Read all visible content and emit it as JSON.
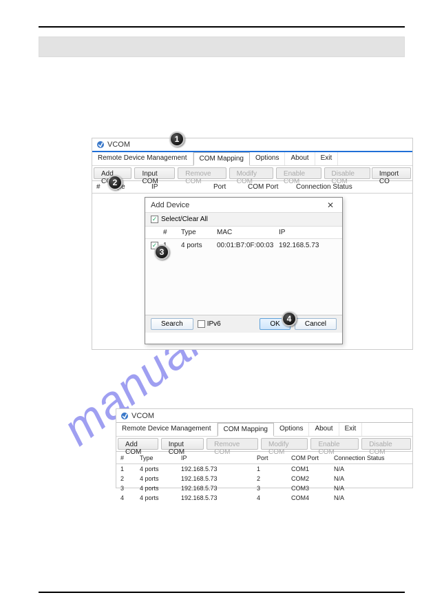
{
  "watermark": "manualshive.com",
  "app": {
    "title": "VCOM"
  },
  "menu": {
    "items": [
      "Remote Device Management",
      "COM Mapping",
      "Options",
      "About",
      "Exit"
    ],
    "selected_index": 1
  },
  "toolbar": {
    "add_com": "Add COM",
    "input_com": "Input COM",
    "remove_com": "Remove COM",
    "modify_com": "Modify COM",
    "enable_com": "Enable COM",
    "disable_com": "Disable COM",
    "import_com": "Import CO"
  },
  "columns": {
    "hash": "#",
    "type": "Type",
    "ip": "IP",
    "port": "Port",
    "com_port": "COM Port",
    "connection_status": "Connection Status"
  },
  "add_device": {
    "title": "Add Device",
    "select_clear_all": "Select/Clear All",
    "columns": {
      "hash": "#",
      "type": "Type",
      "mac": "MAC",
      "ip": "IP"
    },
    "rows": [
      {
        "checked": true,
        "index": "1",
        "type": "4 ports",
        "mac": "00:01:B7:0F:00:03",
        "ip": "192.168.5.73"
      }
    ],
    "search": "Search",
    "ipv6": "IPv6",
    "ok": "OK",
    "cancel": "Cancel"
  },
  "result": {
    "rows": [
      {
        "index": "1",
        "type": "4 ports",
        "ip": "192.168.5.73",
        "port": "1",
        "com_port": "COM1",
        "status": "N/A"
      },
      {
        "index": "2",
        "type": "4 ports",
        "ip": "192.168.5.73",
        "port": "2",
        "com_port": "COM2",
        "status": "N/A"
      },
      {
        "index": "3",
        "type": "4 ports",
        "ip": "192.168.5.73",
        "port": "3",
        "com_port": "COM3",
        "status": "N/A"
      },
      {
        "index": "4",
        "type": "4 ports",
        "ip": "192.168.5.73",
        "port": "4",
        "com_port": "COM4",
        "status": "N/A"
      }
    ]
  },
  "callouts": {
    "c1": "1",
    "c2": "2",
    "c3": "3",
    "c4": "4"
  }
}
